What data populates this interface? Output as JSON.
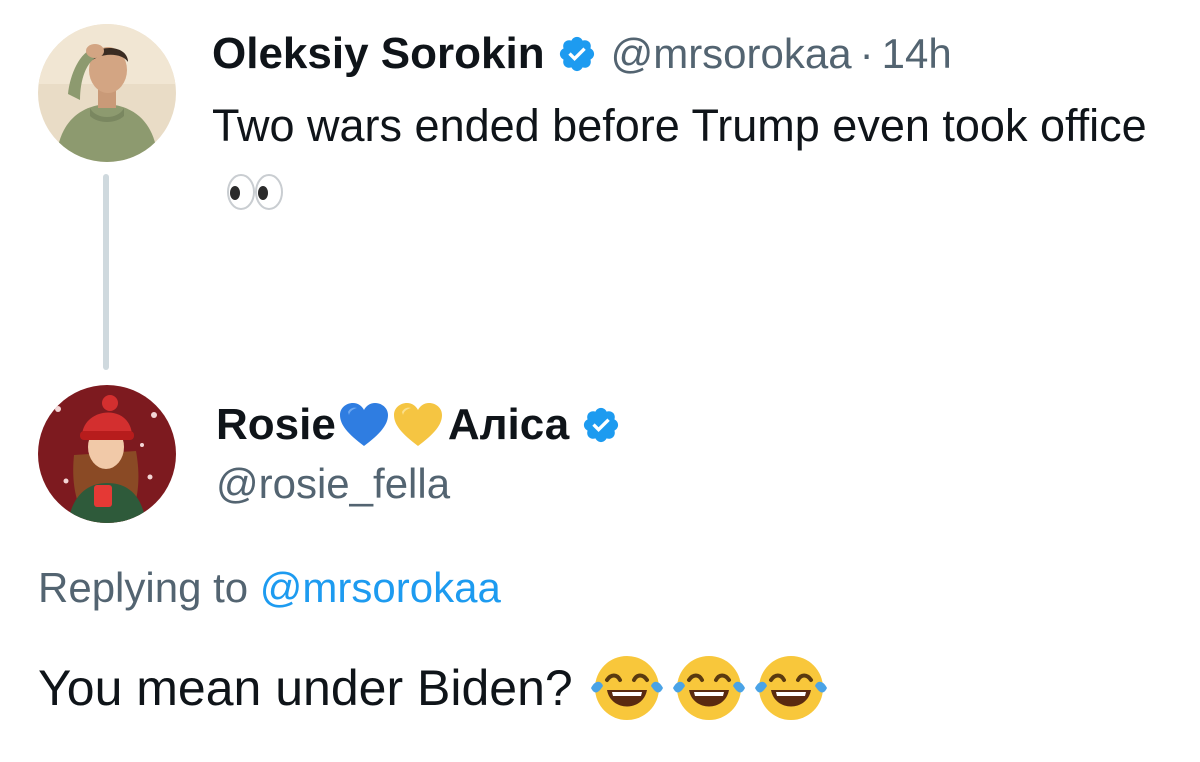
{
  "parent_tweet": {
    "author_name": "Oleksiy Sorokin",
    "handle": "@mrsorokaa",
    "separator": "·",
    "time": "14h",
    "text": "Two wars ended before Trump even took office",
    "trailing_emoji": "eyes-emoji",
    "verified": true,
    "avatar": "person-in-green-hoodie-avatar"
  },
  "reply": {
    "author_name_prefix": "Rosie",
    "name_emojis": [
      "blue-heart-emoji",
      "yellow-heart-emoji"
    ],
    "author_name_suffix": "Аліса",
    "handle": "@rosie_fella",
    "verified": true,
    "avatar": "illustrated-girl-red-hat-avatar",
    "replying_to_label": "Replying to",
    "replying_to_handle": "@mrsorokaa",
    "text": "You mean under Biden?",
    "trailing_emojis": [
      "tears-of-joy-emoji",
      "tears-of-joy-emoji",
      "tears-of-joy-emoji"
    ]
  },
  "colors": {
    "verified_blue": "#1d9bf0",
    "secondary_text": "#536471",
    "primary_text": "#0f1419",
    "thread_line": "#cfd9de",
    "blue_heart": "#2f7de1",
    "yellow_heart": "#f5c542"
  }
}
